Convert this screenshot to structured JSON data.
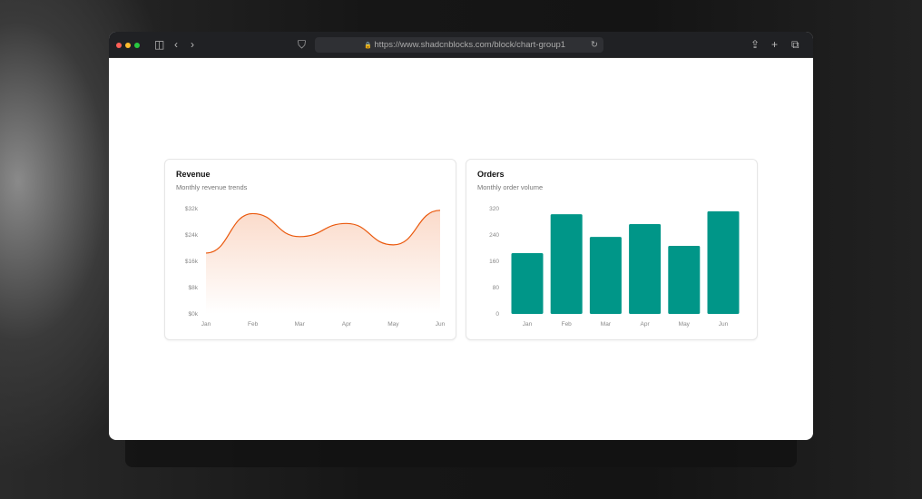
{
  "browser": {
    "url": "https://www.shadcnblocks.com/block/chart-group1",
    "icons": [
      "sidebar-icon",
      "back-icon",
      "forward-icon",
      "shield-icon",
      "lock-icon",
      "reload-icon",
      "share-icon",
      "new-tab-icon",
      "tabs-icon"
    ]
  },
  "chart_data": [
    {
      "type": "area",
      "title": "Revenue",
      "subtitle": "Monthly revenue trends",
      "categories": [
        "Jan",
        "Feb",
        "Mar",
        "Apr",
        "May",
        "Jun"
      ],
      "values": [
        18.5,
        30.5,
        23.5,
        27.5,
        21,
        31.5
      ],
      "unit": "k USD",
      "yticks": [
        "$0k",
        "$8k",
        "$16k",
        "$24k",
        "$32k"
      ],
      "ylim": [
        0,
        32
      ],
      "grid": false,
      "color": "#ea580c"
    },
    {
      "type": "bar",
      "title": "Orders",
      "subtitle": "Monthly order volume",
      "categories": [
        "Jan",
        "Feb",
        "Mar",
        "Apr",
        "May",
        "Jun"
      ],
      "values": [
        185,
        303,
        234,
        273,
        207,
        312
      ],
      "yticks": [
        "0",
        "80",
        "160",
        "240",
        "320"
      ],
      "ylim": [
        0,
        320
      ],
      "grid": false,
      "color": "#009688"
    }
  ]
}
